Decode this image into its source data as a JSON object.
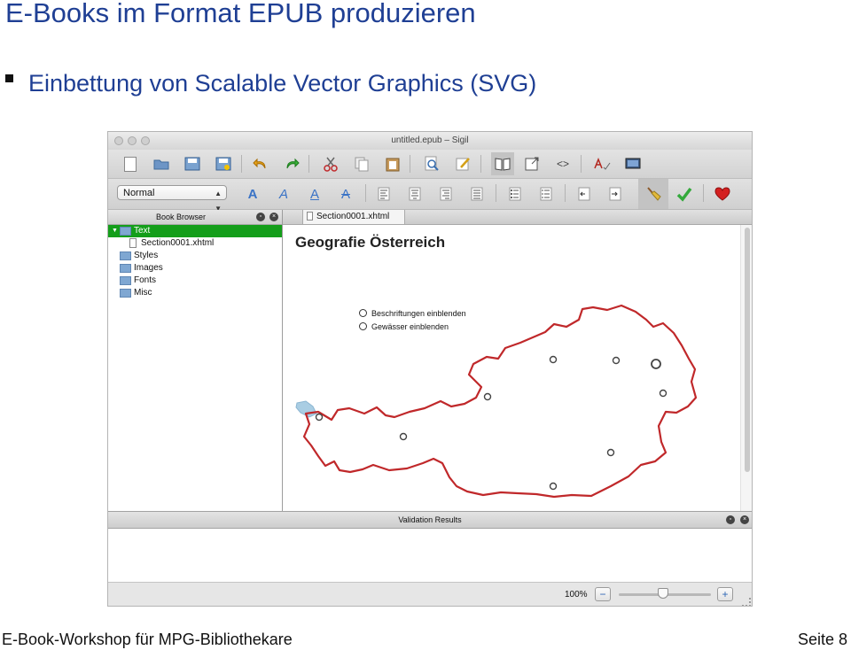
{
  "slide": {
    "title": "E-Books im Format EPUB produzieren",
    "bullet": "Einbettung von Scalable Vector Graphics (SVG)",
    "footer_left": "E-Book-Workshop für MPG-Bibliothekare",
    "footer_right": "Seite 8"
  },
  "window": {
    "title": "untitled.epub – Sigil"
  },
  "toolbar": {
    "style_select_value": "Normal",
    "row1_icons": [
      "new-file-icon",
      "open-folder-icon",
      "save-icon",
      "save-as-icon",
      "undo-icon",
      "redo-icon",
      "cut-icon",
      "copy-icon",
      "paste-icon",
      "find-icon",
      "edit-metadata-icon",
      "book-view-icon",
      "split-view-icon",
      "code-view-icon",
      "spellcheck-icon",
      "tools-icon"
    ],
    "row2_icons": [
      "bold-icon",
      "italic-icon",
      "underline-icon",
      "strikethrough-icon",
      "align-left-icon",
      "align-center-icon",
      "align-right-icon",
      "justify-icon",
      "bullet-list-icon",
      "numbered-list-icon",
      "decrease-indent-icon",
      "increase-indent-icon",
      "clean-source-icon",
      "validate-icon",
      "donate-icon"
    ]
  },
  "book_browser": {
    "title": "Book Browser",
    "items": [
      {
        "label": "Text",
        "selected": true
      },
      {
        "label": "Section0001.xhtml"
      },
      {
        "label": "Styles"
      },
      {
        "label": "Images"
      },
      {
        "label": "Fonts"
      },
      {
        "label": "Misc"
      }
    ]
  },
  "editor": {
    "tab_label": "Section0001.xhtml",
    "doc_title": "Geografie Österreich",
    "options": [
      "Beschriftungen einblenden",
      "Gewässer einblenden"
    ],
    "map_stroke_color": "#c0282a",
    "lake_color": "#a9cde3"
  },
  "validation": {
    "title": "Validation Results"
  },
  "status": {
    "zoom": "100%",
    "zoom_out": "−",
    "zoom_in": "+",
    "zoom_fraction": 0.45
  },
  "colors": {
    "title_blue": "#1f3f94",
    "selection_green": "#149e1a"
  }
}
